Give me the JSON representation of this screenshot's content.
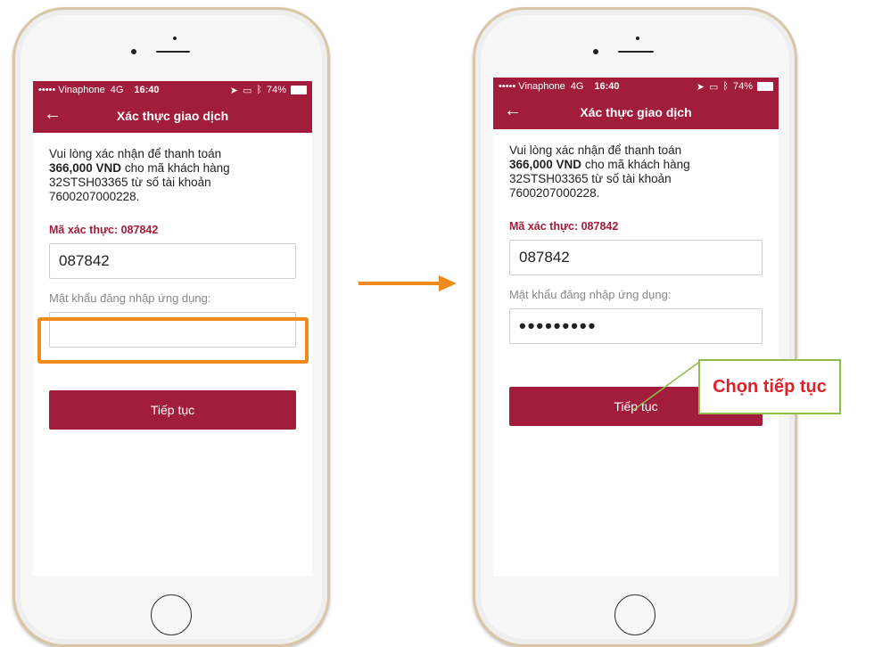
{
  "status_bar": {
    "carrier": "••••• Vinaphone",
    "network": "4G",
    "time": "16:40",
    "battery": "74%"
  },
  "navbar": {
    "title": "Xác thực giao dịch"
  },
  "message": {
    "line_prefix": "Vui lòng xác nhận để thanh toán",
    "amount": "366,000 VND",
    "line_suffix": " cho mã khách hàng 32STSH03365 từ số tài khoản 7600207000228."
  },
  "auth_code_label": "Mã xác thực: 087842",
  "auth_code_value": "087842",
  "password_label": "Mật khẩu đăng nhập ứng dụng:",
  "password_left_value": "",
  "password_right_value": "•••••••••",
  "continue_label": "Tiếp tục",
  "callout_text": "Chọn tiếp tục",
  "colors": {
    "brand": "#a11d3b",
    "highlight": "#f08a1c",
    "arrow": "#f08a1c",
    "callout_border": "#8dbb4e",
    "callout_text": "#e0202a"
  }
}
